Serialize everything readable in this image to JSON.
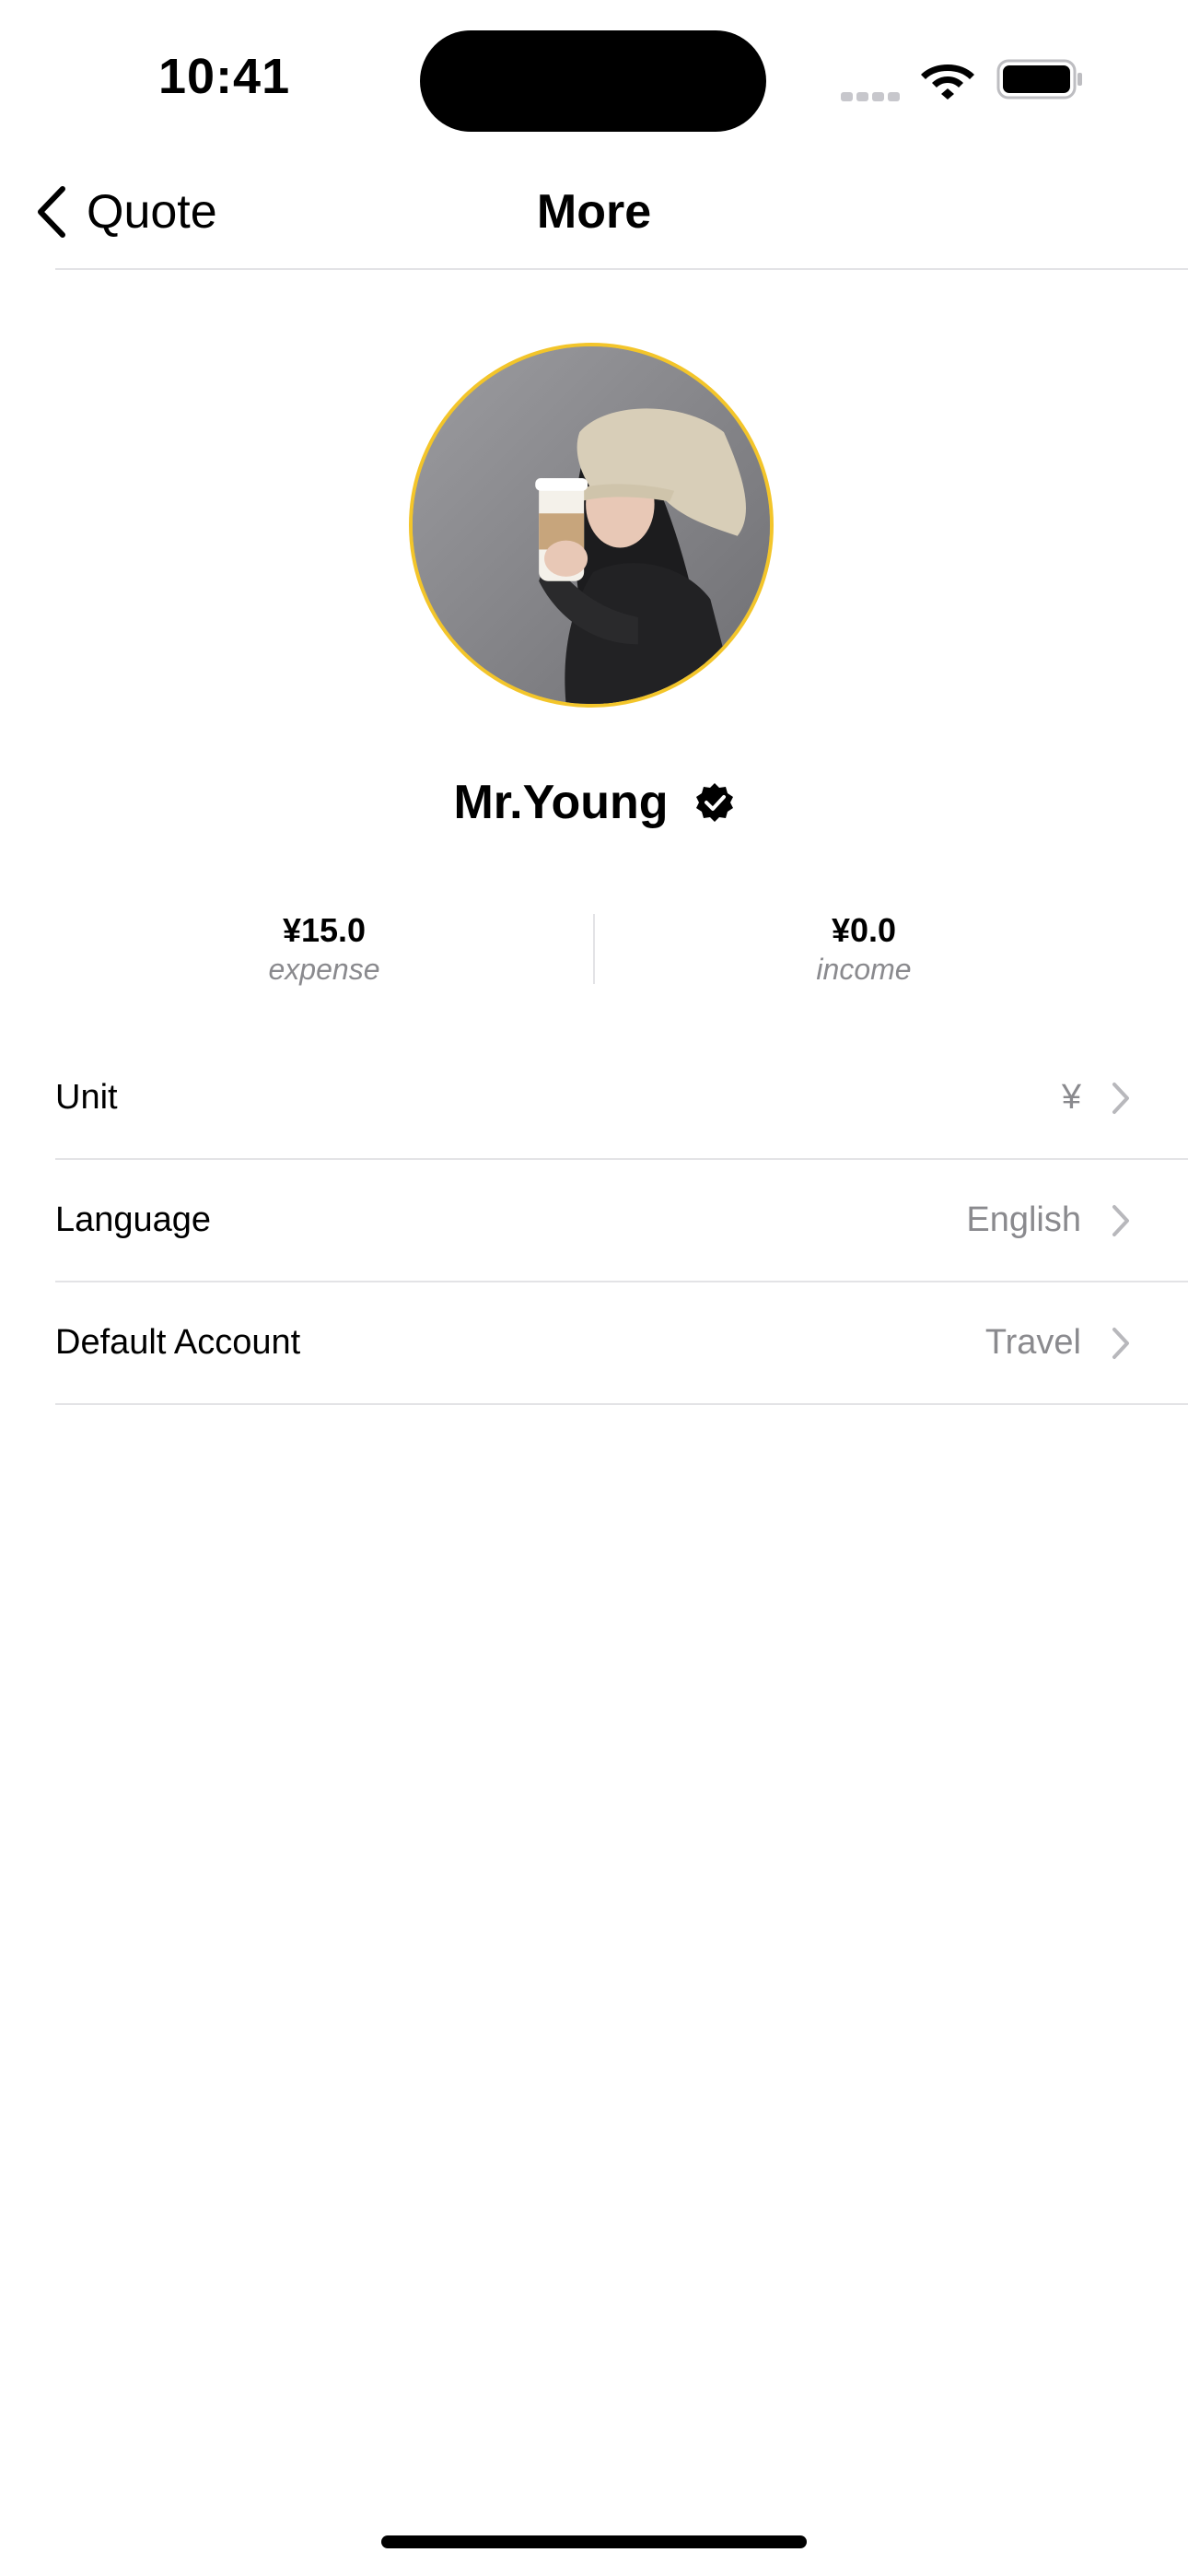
{
  "status_bar": {
    "time": "10:41"
  },
  "nav": {
    "back_label": "Quote",
    "title": "More"
  },
  "profile": {
    "name": "Mr.Young",
    "avatar_ring_color": "#f3c52a"
  },
  "stats": [
    {
      "value": "¥15.0",
      "label": "expense"
    },
    {
      "value": "¥0.0",
      "label": "income"
    }
  ],
  "settings": [
    {
      "label": "Unit",
      "value": "¥"
    },
    {
      "label": "Language",
      "value": "English"
    },
    {
      "label": "Default Account",
      "value": "Travel"
    }
  ],
  "icons": {
    "back": "chevron-left-icon",
    "verified": "verified-badge-icon",
    "row_disclosure": "chevron-right-icon",
    "wifi": "wifi-icon",
    "battery": "battery-icon",
    "signal": "cell-signal-icon"
  }
}
